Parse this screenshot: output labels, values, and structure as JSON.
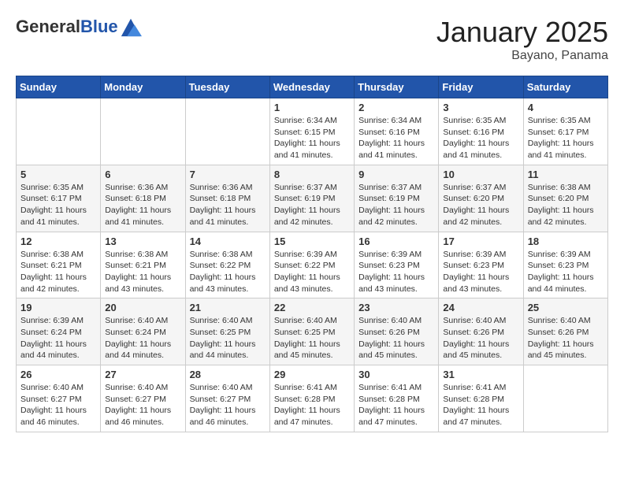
{
  "header": {
    "logo_general": "General",
    "logo_blue": "Blue",
    "month": "January 2025",
    "location": "Bayano, Panama"
  },
  "weekdays": [
    "Sunday",
    "Monday",
    "Tuesday",
    "Wednesday",
    "Thursday",
    "Friday",
    "Saturday"
  ],
  "weeks": [
    [
      {
        "day": "",
        "info": ""
      },
      {
        "day": "",
        "info": ""
      },
      {
        "day": "",
        "info": ""
      },
      {
        "day": "1",
        "info": "Sunrise: 6:34 AM\nSunset: 6:15 PM\nDaylight: 11 hours\nand 41 minutes."
      },
      {
        "day": "2",
        "info": "Sunrise: 6:34 AM\nSunset: 6:16 PM\nDaylight: 11 hours\nand 41 minutes."
      },
      {
        "day": "3",
        "info": "Sunrise: 6:35 AM\nSunset: 6:16 PM\nDaylight: 11 hours\nand 41 minutes."
      },
      {
        "day": "4",
        "info": "Sunrise: 6:35 AM\nSunset: 6:17 PM\nDaylight: 11 hours\nand 41 minutes."
      }
    ],
    [
      {
        "day": "5",
        "info": "Sunrise: 6:35 AM\nSunset: 6:17 PM\nDaylight: 11 hours\nand 41 minutes."
      },
      {
        "day": "6",
        "info": "Sunrise: 6:36 AM\nSunset: 6:18 PM\nDaylight: 11 hours\nand 41 minutes."
      },
      {
        "day": "7",
        "info": "Sunrise: 6:36 AM\nSunset: 6:18 PM\nDaylight: 11 hours\nand 41 minutes."
      },
      {
        "day": "8",
        "info": "Sunrise: 6:37 AM\nSunset: 6:19 PM\nDaylight: 11 hours\nand 42 minutes."
      },
      {
        "day": "9",
        "info": "Sunrise: 6:37 AM\nSunset: 6:19 PM\nDaylight: 11 hours\nand 42 minutes."
      },
      {
        "day": "10",
        "info": "Sunrise: 6:37 AM\nSunset: 6:20 PM\nDaylight: 11 hours\nand 42 minutes."
      },
      {
        "day": "11",
        "info": "Sunrise: 6:38 AM\nSunset: 6:20 PM\nDaylight: 11 hours\nand 42 minutes."
      }
    ],
    [
      {
        "day": "12",
        "info": "Sunrise: 6:38 AM\nSunset: 6:21 PM\nDaylight: 11 hours\nand 42 minutes."
      },
      {
        "day": "13",
        "info": "Sunrise: 6:38 AM\nSunset: 6:21 PM\nDaylight: 11 hours\nand 43 minutes."
      },
      {
        "day": "14",
        "info": "Sunrise: 6:38 AM\nSunset: 6:22 PM\nDaylight: 11 hours\nand 43 minutes."
      },
      {
        "day": "15",
        "info": "Sunrise: 6:39 AM\nSunset: 6:22 PM\nDaylight: 11 hours\nand 43 minutes."
      },
      {
        "day": "16",
        "info": "Sunrise: 6:39 AM\nSunset: 6:23 PM\nDaylight: 11 hours\nand 43 minutes."
      },
      {
        "day": "17",
        "info": "Sunrise: 6:39 AM\nSunset: 6:23 PM\nDaylight: 11 hours\nand 43 minutes."
      },
      {
        "day": "18",
        "info": "Sunrise: 6:39 AM\nSunset: 6:23 PM\nDaylight: 11 hours\nand 44 minutes."
      }
    ],
    [
      {
        "day": "19",
        "info": "Sunrise: 6:39 AM\nSunset: 6:24 PM\nDaylight: 11 hours\nand 44 minutes."
      },
      {
        "day": "20",
        "info": "Sunrise: 6:40 AM\nSunset: 6:24 PM\nDaylight: 11 hours\nand 44 minutes."
      },
      {
        "day": "21",
        "info": "Sunrise: 6:40 AM\nSunset: 6:25 PM\nDaylight: 11 hours\nand 44 minutes."
      },
      {
        "day": "22",
        "info": "Sunrise: 6:40 AM\nSunset: 6:25 PM\nDaylight: 11 hours\nand 45 minutes."
      },
      {
        "day": "23",
        "info": "Sunrise: 6:40 AM\nSunset: 6:26 PM\nDaylight: 11 hours\nand 45 minutes."
      },
      {
        "day": "24",
        "info": "Sunrise: 6:40 AM\nSunset: 6:26 PM\nDaylight: 11 hours\nand 45 minutes."
      },
      {
        "day": "25",
        "info": "Sunrise: 6:40 AM\nSunset: 6:26 PM\nDaylight: 11 hours\nand 45 minutes."
      }
    ],
    [
      {
        "day": "26",
        "info": "Sunrise: 6:40 AM\nSunset: 6:27 PM\nDaylight: 11 hours\nand 46 minutes."
      },
      {
        "day": "27",
        "info": "Sunrise: 6:40 AM\nSunset: 6:27 PM\nDaylight: 11 hours\nand 46 minutes."
      },
      {
        "day": "28",
        "info": "Sunrise: 6:40 AM\nSunset: 6:27 PM\nDaylight: 11 hours\nand 46 minutes."
      },
      {
        "day": "29",
        "info": "Sunrise: 6:41 AM\nSunset: 6:28 PM\nDaylight: 11 hours\nand 47 minutes."
      },
      {
        "day": "30",
        "info": "Sunrise: 6:41 AM\nSunset: 6:28 PM\nDaylight: 11 hours\nand 47 minutes."
      },
      {
        "day": "31",
        "info": "Sunrise: 6:41 AM\nSunset: 6:28 PM\nDaylight: 11 hours\nand 47 minutes."
      },
      {
        "day": "",
        "info": ""
      }
    ]
  ]
}
